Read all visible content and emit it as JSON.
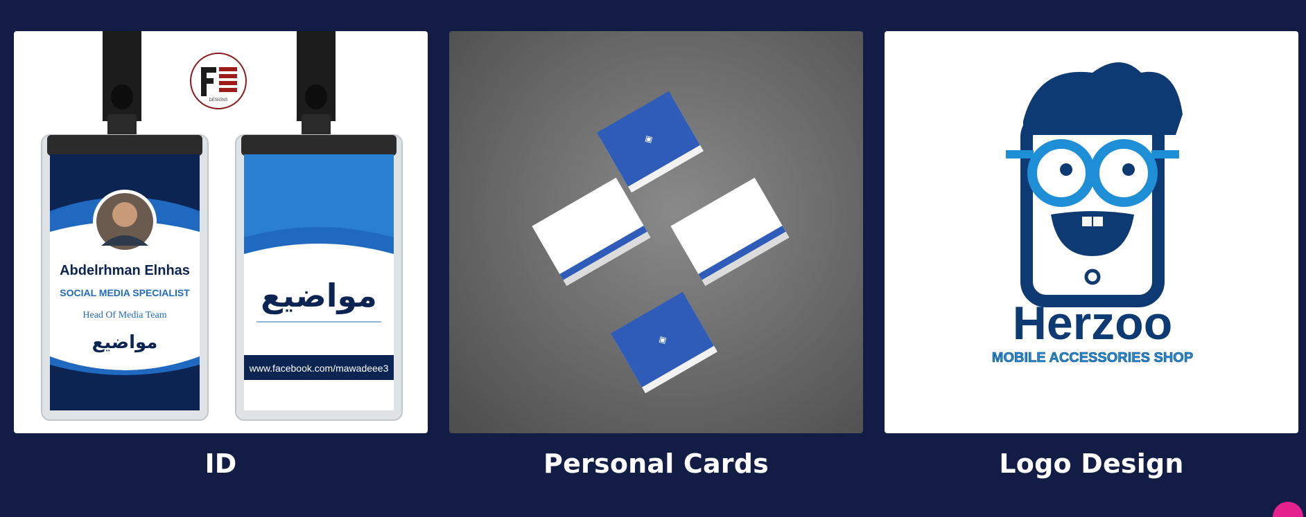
{
  "projects": [
    {
      "title": "ID",
      "image_alt": "ID card badge mockup",
      "badge_front": {
        "name": "Abdelrhman Elnhas",
        "role": "SOCIAL MEDIA SPECIALIST",
        "team": "Head Of Media Team",
        "brand_ar": "مواضيع"
      },
      "badge_back": {
        "brand_ar": "مواضيع",
        "facebook": "www.facebook.com/mawadeee3"
      },
      "logo_caption": "DESIGNS"
    },
    {
      "title": "Personal Cards",
      "image_alt": "Business cards mockup"
    },
    {
      "title": "Logo Design",
      "image_alt": "Herzoo logo",
      "logo_name": "Herzoo",
      "logo_tagline": "MOBILE ACCESSORIES SHOP"
    }
  ],
  "colors": {
    "background": "#131c45",
    "caption": "#ffffff",
    "accent": "#e5218d",
    "brand_blue": "#1a5fb4"
  },
  "icons": {
    "fab": "floating-action-button"
  }
}
